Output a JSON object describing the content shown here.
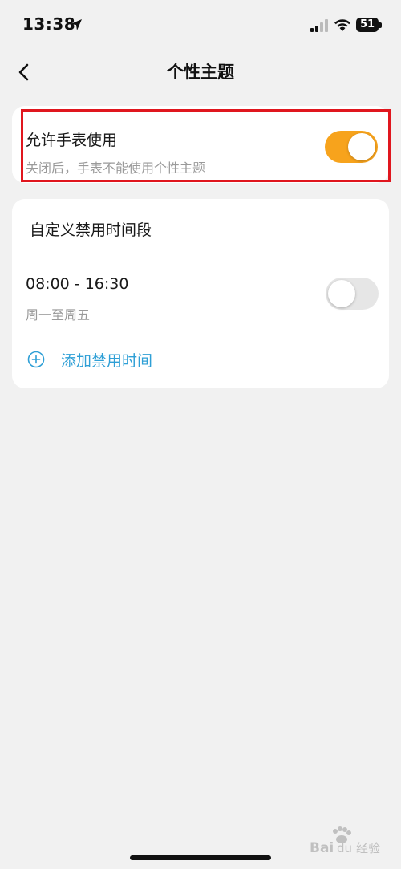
{
  "status_bar": {
    "time": "13:38",
    "battery": "51",
    "icons": [
      "location-arrow-icon",
      "cellular-signal-icon",
      "wifi-icon",
      "battery-icon"
    ]
  },
  "nav": {
    "title": "个性主题",
    "back_icon": "chevron-left-icon"
  },
  "allow_watch": {
    "title": "允许手表使用",
    "subtitle": "关闭后，手表不能使用个性主题",
    "enabled": true,
    "toggle_color": "#f7a31c"
  },
  "schedule": {
    "title": "自定义禁用时间段",
    "items": [
      {
        "time_range": "08:00 - 16:30",
        "days": "周一至周五",
        "enabled": false
      }
    ],
    "add_label": "添加禁用时间",
    "add_icon": "plus-circle-icon",
    "accent_color": "#2e9fd6"
  },
  "highlight_color": "#e0161e",
  "watermark": "Bai 经验"
}
